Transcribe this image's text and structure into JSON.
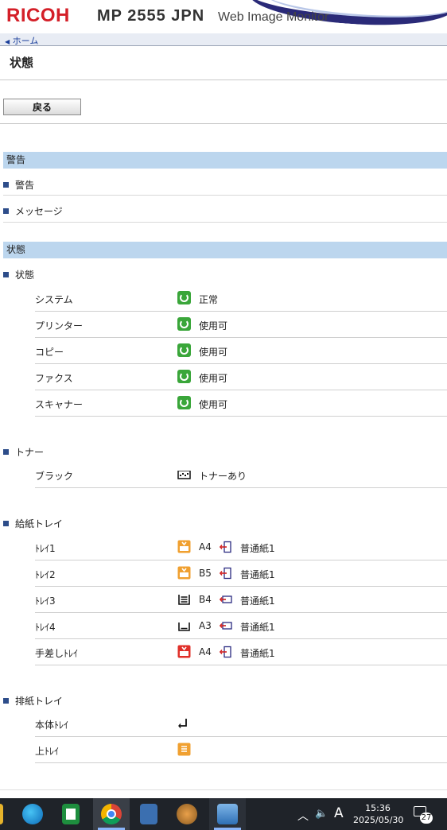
{
  "header": {
    "brand": "RICOH",
    "model": "MP 2555 JPN",
    "app": "Web Image Monitor"
  },
  "nav": {
    "home": "ホーム"
  },
  "page": {
    "title": "状態",
    "back_label": "戻る"
  },
  "sections": {
    "alerts": {
      "band": "警告",
      "items": [
        "警告",
        "メッセージ"
      ]
    },
    "status": {
      "band": "状態",
      "heading": "状態",
      "rows": [
        {
          "label": "システム",
          "value": "正常"
        },
        {
          "label": "プリンター",
          "value": "使用可"
        },
        {
          "label": "コピー",
          "value": "使用可"
        },
        {
          "label": "ファクス",
          "value": "使用可"
        },
        {
          "label": "スキャナー",
          "value": "使用可"
        }
      ]
    },
    "toner": {
      "heading": "トナー",
      "rows": [
        {
          "label": "ブラック",
          "value": "トナーあり"
        }
      ]
    },
    "paper_tray": {
      "heading": "給紙トレイ",
      "rows": [
        {
          "label": "ﾄﾚｲ1",
          "size": "A4",
          "type": "普通紙1",
          "icon": "tray-partial-orange-icon"
        },
        {
          "label": "ﾄﾚｲ2",
          "size": "B5",
          "type": "普通紙1",
          "icon": "tray-partial-orange-icon"
        },
        {
          "label": "ﾄﾚｲ3",
          "size": "B4",
          "type": "普通紙1",
          "icon": "tray-full-icon"
        },
        {
          "label": "ﾄﾚｲ4",
          "size": "A3",
          "type": "普通紙1",
          "icon": "tray-empty-icon"
        },
        {
          "label": "手差しﾄﾚｲ",
          "size": "A4",
          "type": "普通紙1",
          "icon": "bypass-tray-red-icon"
        }
      ]
    },
    "output_tray": {
      "heading": "排紙トレイ",
      "rows": [
        {
          "label": "本体ﾄﾚｲ",
          "icon": "output-tray-icon"
        },
        {
          "label": "上ﾄﾚｲ",
          "icon": "output-tray-orange-icon"
        }
      ]
    }
  },
  "taskbar": {
    "time": "15:36",
    "date": "2025/05/30",
    "notifications": "27",
    "ime": "A"
  },
  "colors": {
    "brand_red": "#d41f28",
    "band_blue": "#bcd6ee",
    "status_ok": "#3aa63a",
    "tray_orange": "#f0a030",
    "tray_red": "#e0302a"
  }
}
